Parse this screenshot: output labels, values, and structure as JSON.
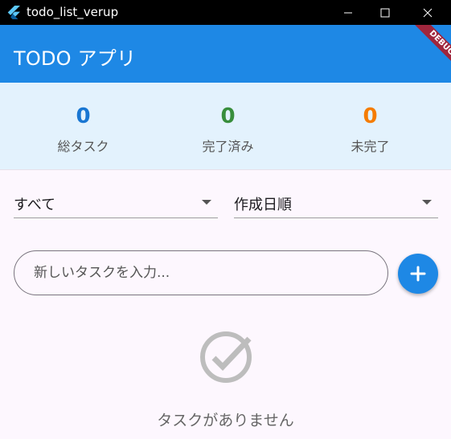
{
  "window": {
    "title": "todo_list_verup",
    "icon": "flutter-icon",
    "controls": [
      "minimize-icon",
      "maximize-icon",
      "close-icon"
    ]
  },
  "appbar": {
    "title": "TODO アプリ",
    "color": "#1e88e5",
    "debug_banner": "DEBUG"
  },
  "stats": {
    "total": {
      "count": "0",
      "label": "総タスク",
      "color": "#1976d2"
    },
    "done": {
      "count": "0",
      "label": "完了済み",
      "color": "#388e3c"
    },
    "pending": {
      "count": "0",
      "label": "未完了",
      "color": "#f57c00"
    }
  },
  "filter": {
    "selected": "すべて"
  },
  "sort": {
    "selected": "作成日順"
  },
  "new_task": {
    "placeholder": "新しいタスクを入力...",
    "value": ""
  },
  "add_button": {
    "icon": "plus-icon"
  },
  "empty_state": {
    "icon": "check-circle-icon",
    "text": "タスクがありません"
  }
}
